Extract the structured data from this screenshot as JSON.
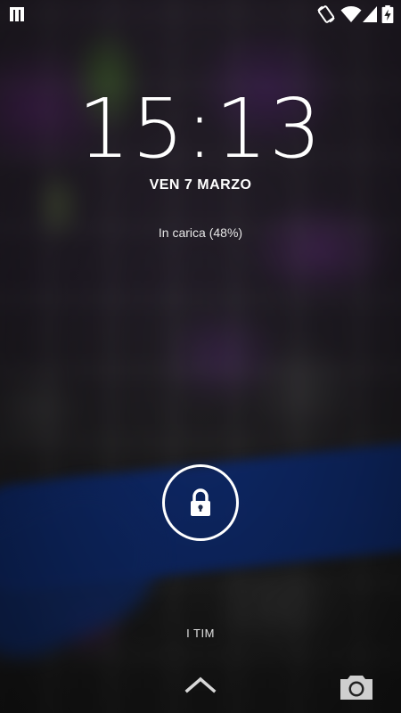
{
  "status_bar": {
    "icons": [
      "notification-icon",
      "screen-rotation-icon",
      "wifi-icon",
      "cellular-signal-icon",
      "battery-charging-icon"
    ]
  },
  "lockscreen": {
    "time": "15:13",
    "date": "VEN 7 MARZO",
    "charging_status": "In carica (48%)",
    "carrier": "I TIM"
  },
  "controls": {
    "lock_icon": "padlock-icon",
    "unlock_hint_icon": "chevron-up-icon",
    "camera_icon": "camera-icon"
  },
  "colors": {
    "text": "#ffffff",
    "river_blue": "#0e2a6e"
  }
}
